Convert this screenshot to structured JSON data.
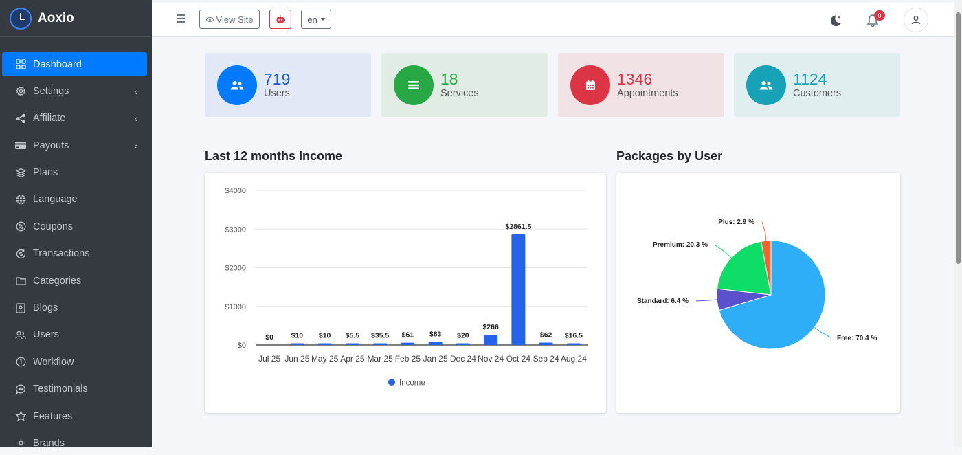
{
  "brand": {
    "name": "Aoxio"
  },
  "sidebar": {
    "items": [
      {
        "label": "Dashboard",
        "icon": "grid-icon",
        "active": true,
        "chevron": false
      },
      {
        "label": "Settings",
        "icon": "gear-icon",
        "active": false,
        "chevron": true
      },
      {
        "label": "Affiliate",
        "icon": "share-icon",
        "active": false,
        "chevron": true
      },
      {
        "label": "Payouts",
        "icon": "credit-card-icon",
        "active": false,
        "chevron": true
      },
      {
        "label": "Plans",
        "icon": "layers-icon",
        "active": false,
        "chevron": false
      },
      {
        "label": "Language",
        "icon": "globe-icon",
        "active": false,
        "chevron": false
      },
      {
        "label": "Coupons",
        "icon": "coupon-icon",
        "active": false,
        "chevron": false
      },
      {
        "label": "Transactions",
        "icon": "transactions-icon",
        "active": false,
        "chevron": false
      },
      {
        "label": "Categories",
        "icon": "folder-icon",
        "active": false,
        "chevron": false
      },
      {
        "label": "Blogs",
        "icon": "blog-icon",
        "active": false,
        "chevron": false
      },
      {
        "label": "Users",
        "icon": "users-icon",
        "active": false,
        "chevron": false
      },
      {
        "label": "Workflow",
        "icon": "workflow-icon",
        "active": false,
        "chevron": false
      },
      {
        "label": "Testimonials",
        "icon": "chat-icon",
        "active": false,
        "chevron": false
      },
      {
        "label": "Features",
        "icon": "star-icon",
        "active": false,
        "chevron": false
      },
      {
        "label": "Brands",
        "icon": "brands-icon",
        "active": false,
        "chevron": false
      }
    ]
  },
  "topbar": {
    "view_site": "View Site",
    "language": "en",
    "notification_count": "0"
  },
  "stats": [
    {
      "value": "719",
      "label": "Users",
      "icon": "users-icon",
      "bg": "#e3e8f7",
      "circle": "#007bff",
      "text_color": "#1a5ccc"
    },
    {
      "value": "18",
      "label": "Services",
      "icon": "list-icon",
      "bg": "#e1ece4",
      "circle": "#28a745",
      "text_color": "#28a745"
    },
    {
      "value": "1346",
      "label": "Appointments",
      "icon": "calendar-icon",
      "bg": "#f1e2e6",
      "circle": "#dc3545",
      "text_color": "#dc3545"
    },
    {
      "value": "1124",
      "label": "Customers",
      "icon": "users-icon",
      "bg": "#e0eef0",
      "circle": "#17a2b8",
      "text_color": "#17a2b8"
    }
  ],
  "income": {
    "title": "Last 12 months Income"
  },
  "packages": {
    "title": "Packages by User"
  },
  "chart_data": [
    {
      "type": "bar",
      "title": "Last 12 months Income",
      "categories": [
        "Jul 25",
        "Jun 25",
        "May 25",
        "Apr 25",
        "Mar 25",
        "Feb 25",
        "Jan 25",
        "Dec 24",
        "Nov 24",
        "Oct 24",
        "Sep 24",
        "Aug 24"
      ],
      "series": [
        {
          "name": "Income",
          "values": [
            0,
            10,
            10,
            5.5,
            35.5,
            61,
            83,
            20,
            266,
            2861.5,
            62,
            16.5
          ],
          "color": "#2563eb"
        }
      ],
      "data_labels": [
        "$0",
        "$10",
        "$10",
        "$5.5",
        "$35.5",
        "$61",
        "$83",
        "$20",
        "$266",
        "$2861.5",
        "$62",
        "$16.5"
      ],
      "yticks": [
        "$0",
        "$1000",
        "$2000",
        "$3000",
        "$4000"
      ],
      "ylim": [
        0,
        4000
      ],
      "grid": true,
      "legend": "bottom"
    },
    {
      "type": "pie",
      "title": "Packages by User",
      "slices": [
        {
          "name": "Free",
          "value": 70.4,
          "label": "Free: 70.4 %",
          "color": "#2eaef7"
        },
        {
          "name": "Standard",
          "value": 6.4,
          "label": "Standard: 6.4 %",
          "color": "#5b51cf"
        },
        {
          "name": "Premium",
          "value": 20.3,
          "label": "Premium: 20.3 %",
          "color": "#0edd68"
        },
        {
          "name": "Plus",
          "value": 2.9,
          "label": "Plus: 2.9 %",
          "color": "#f4632e"
        }
      ]
    }
  ]
}
